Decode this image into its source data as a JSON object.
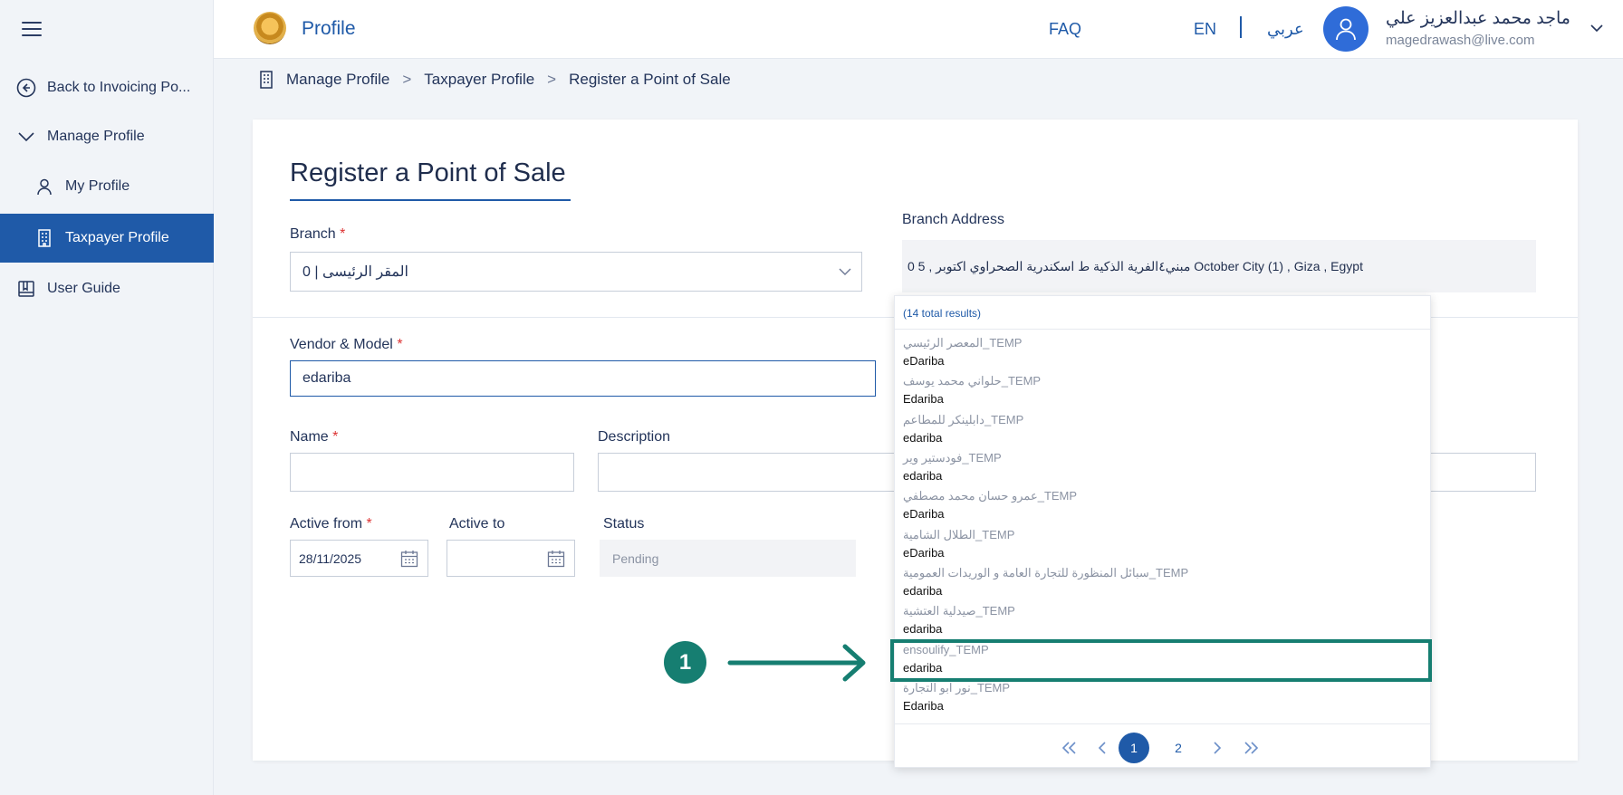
{
  "header": {
    "title": "Profile",
    "links": {
      "faq": "FAQ",
      "en": "EN",
      "arabic": "عربي"
    },
    "user": {
      "name": "ماجد محمد عبدالعزيز علي",
      "email": "magedrawash@live.com"
    }
  },
  "sidebar": {
    "items": [
      {
        "label": "Back to Invoicing Po...",
        "icon": "back-circle-icon"
      },
      {
        "label": "Manage Profile",
        "icon": "chevron-down-icon"
      },
      {
        "label": "My Profile",
        "icon": "user-icon"
      },
      {
        "label": "Taxpayer Profile",
        "icon": "building-icon",
        "active": true
      },
      {
        "label": "User Guide",
        "icon": "book-icon"
      }
    ]
  },
  "breadcrumb": [
    "Manage Profile",
    "Taxpayer Profile",
    "Register a Point of Sale"
  ],
  "form": {
    "title": "Register a Point of Sale",
    "branch": {
      "label": "Branch",
      "value": "المقر الرئيسى | 0"
    },
    "branch_address": {
      "label": "Branch Address",
      "value": "0 5 , مبني٤الفرية الذكية ط اسكندرية الصحراوي اكتوبر October City (1) , Giza , Egypt"
    },
    "vendor_model": {
      "label": "Vendor & Model",
      "value": "edariba"
    },
    "name": {
      "label": "Name",
      "value": ""
    },
    "description": {
      "label": "Description",
      "value": ""
    },
    "active_from": {
      "label": "Active from",
      "value": "28/11/2025"
    },
    "active_to": {
      "label": "Active to",
      "value": ""
    },
    "status": {
      "label": "Status",
      "value": "Pending"
    },
    "required_mark": "*"
  },
  "dropdown": {
    "total": "(14 total results)",
    "items": [
      {
        "name": "المعصر الرئيسي_TEMP",
        "vendor": "eDariba"
      },
      {
        "name": "حلواني محمد يوسف_TEMP",
        "vendor": "Edariba"
      },
      {
        "name": "دابلينكر للمطاعم_TEMP",
        "vendor": "edariba"
      },
      {
        "name": "فودستير وير_TEMP",
        "vendor": "edariba"
      },
      {
        "name": "عمرو حسان محمد مصطفي_TEMP",
        "vendor": "eDariba"
      },
      {
        "name": "الطلال الشامية_TEMP",
        "vendor": "eDariba"
      },
      {
        "name": "سبائل المنظورة للتجارة العامة و الوريدات العمومية_TEMP",
        "vendor": "edariba"
      },
      {
        "name": "صيدلية العتشية_TEMP",
        "vendor": "edariba"
      },
      {
        "name": "ensoulify_TEMP",
        "vendor": "edariba"
      },
      {
        "name": "نور ابو التجارة_TEMP",
        "vendor": "Edariba"
      }
    ],
    "pager": {
      "pages": [
        "1",
        "2"
      ],
      "current": "1"
    }
  },
  "annotation": {
    "step": "1"
  },
  "colors": {
    "primary": "#1f5aa8",
    "annotation": "#167e71"
  }
}
